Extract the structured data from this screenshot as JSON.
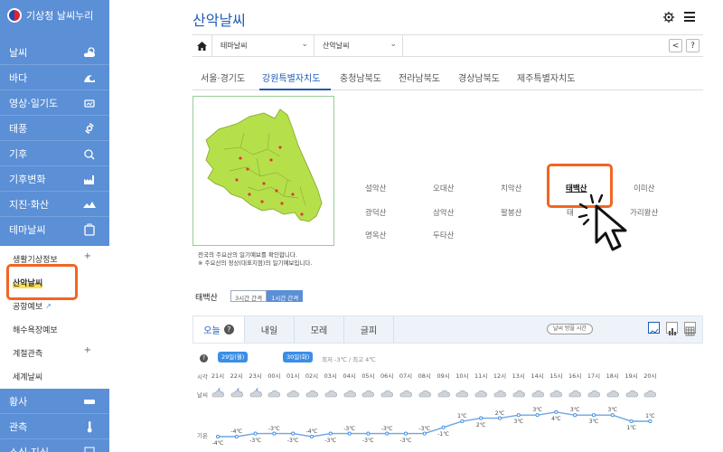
{
  "sidebar": {
    "logo": "기상청 날씨누리",
    "menu": [
      {
        "label": "날씨",
        "icon": "sun-cloud-icon"
      },
      {
        "label": "바다",
        "icon": "wave-icon"
      },
      {
        "label": "영상·일기도",
        "icon": "satellite-icon"
      },
      {
        "label": "태풍",
        "icon": "typhoon-icon"
      },
      {
        "label": "기후",
        "icon": "climate-icon"
      },
      {
        "label": "기후변화",
        "icon": "factory-icon"
      },
      {
        "label": "지진·화산",
        "icon": "earthquake-icon"
      },
      {
        "label": "테마날씨",
        "icon": "theme-icon"
      }
    ],
    "submenu": [
      {
        "label": "생활기상정보",
        "plus": "+"
      },
      {
        "label": "산악날씨",
        "plus": ""
      },
      {
        "label": "공항예보",
        "plus": ""
      },
      {
        "label": "해수욕장예보",
        "plus": ""
      },
      {
        "label": "계절관측",
        "plus": "+"
      },
      {
        "label": "세계날씨",
        "plus": ""
      }
    ],
    "menu_bottom": [
      {
        "label": "황사",
        "icon": "dust-icon"
      },
      {
        "label": "관측",
        "icon": "thermometer-icon"
      },
      {
        "label": "소식·지식",
        "icon": "news-icon"
      }
    ]
  },
  "header": {
    "title": "산악날씨",
    "breadcrumb": {
      "sel1": "테마날씨",
      "sel2": "산악날씨"
    },
    "share": "<",
    "help": "?"
  },
  "region_tabs": [
    "서울·경기도",
    "강원특별자치도",
    "충청남북도",
    "전라남북도",
    "경상남북도",
    "제주특별자치도"
  ],
  "region_active": 1,
  "map": {
    "note_line1": "전국의 주요산의 일기예보를 확인합니다.",
    "note_line2": "※ 주요산의 정상(대표지점)의 일기예보입니다."
  },
  "mountains": [
    [
      "설악산",
      "오대산",
      "치악산",
      "태백산",
      "이미산"
    ],
    [
      "광덕산",
      "삼악산",
      "팔봉산",
      "태",
      "가리왕산"
    ],
    [
      "명옥산",
      "두타산",
      "",
      "",
      ""
    ]
  ],
  "selected": {
    "name": "태백산",
    "intervals": [
      "3시간 간격",
      "1시간 간격"
    ],
    "interval_active": 1
  },
  "day_tabs": [
    "오늘",
    "내일",
    "모레",
    "글피"
  ],
  "obs_button": "날씨 방을 시간",
  "forecast": {
    "date1": "29일(월)",
    "date2": "30일(화)",
    "legend": "최저 -3℃ / 최고 4℃",
    "row_time": "시각",
    "row_weather": "날씨",
    "row_temp": "기온",
    "hours": [
      "21시",
      "22시",
      "23시",
      "00시",
      "01시",
      "02시",
      "03시",
      "04시",
      "05시",
      "06시",
      "07시",
      "08시",
      "09시",
      "10시",
      "11시",
      "12시",
      "13시",
      "14시",
      "15시",
      "16시",
      "17시",
      "18시",
      "19시",
      "20시"
    ],
    "temps": [
      -4,
      -4,
      -3,
      -3,
      -3,
      -4,
      -3,
      -3,
      -3,
      -3,
      -3,
      -3,
      -1,
      1,
      2,
      2,
      3,
      3,
      4,
      3,
      3,
      3,
      1,
      1
    ],
    "weather_icons": [
      "cloud-moon",
      "cloud-moon",
      "cloud-moon",
      "cloud",
      "cloud",
      "cloud",
      "cloud",
      "cloud",
      "cloud",
      "cloud",
      "cloud",
      "cloud",
      "cloud",
      "cloud",
      "cloud",
      "cloud",
      "cloud",
      "cloud",
      "cloud",
      "cloud",
      "cloud",
      "cloud",
      "cloud",
      "cloud"
    ]
  },
  "colors": {
    "sidebar": "#5b8fd6",
    "accent": "#1e5bb8",
    "highlight": "#f26522",
    "map_fill": "#b5e04a"
  }
}
